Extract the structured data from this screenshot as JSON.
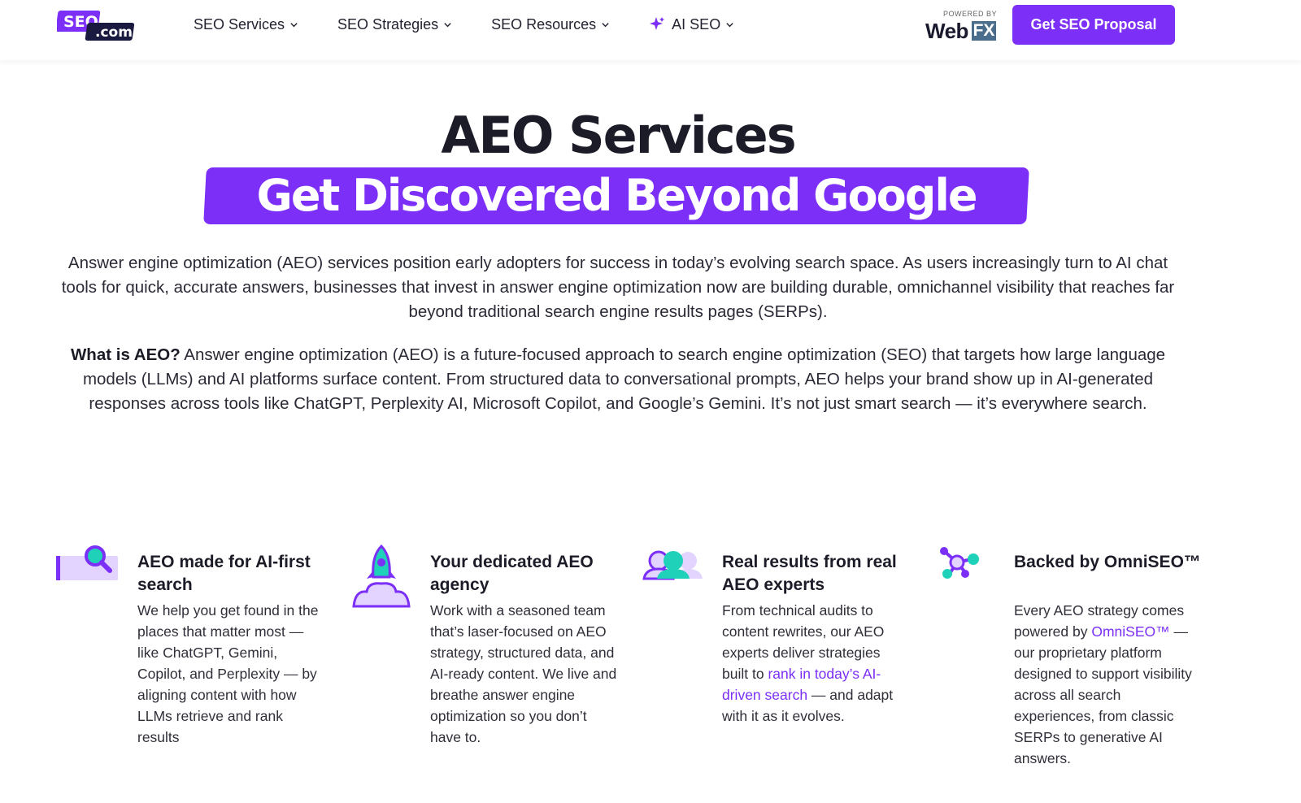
{
  "header": {
    "logo_top": "SEO",
    "logo_bottom": ".com",
    "nav": [
      {
        "label": "SEO Services"
      },
      {
        "label": "SEO Strategies"
      },
      {
        "label": "SEO Resources"
      },
      {
        "label": "AI SEO"
      }
    ],
    "powered_by": "POWERED BY",
    "powered_web": "Web",
    "powered_fx": "FX",
    "cta_label": "Get SEO Proposal"
  },
  "hero": {
    "title": "AEO Services",
    "subtitle": "Get Discovered Beyond Google",
    "intro": "Answer engine optimization (AEO) services position early adopters for success in today’s evolving search space. As users increasingly turn to AI chat tools for quick, accurate answers, businesses that invest in answer engine optimization now are building durable, omnichannel visibility that reaches far beyond traditional search engine results pages (SERPs).",
    "what_label": "What is AEO?",
    "what_text": " Answer engine optimization (AEO) is a future-focused approach to search engine optimization (SEO) that targets how large language models (LLMs) and AI platforms surface content. From structured data to conversational prompts, AEO helps your brand show up in AI-generated responses across tools like ChatGPT, Perplexity AI, Microsoft Copilot, and Google’s Gemini. It’s not just smart search — it’s everywhere search."
  },
  "features": [
    {
      "title": "AEO made for AI-first search",
      "text": "We help you get found in the places that matter most — like ChatGPT, Gemini, Copilot, and Perplexity — by aligning content with how LLMs retrieve and rank results",
      "icon": "search-magnifier-icon"
    },
    {
      "title": "Your dedicated AEO agency",
      "text": "Work with a seasoned team that’s laser-focused on AEO strategy, structured data, and AI-ready content. We live and breathe answer engine optimization so you don’t have to.",
      "icon": "rocket-icon"
    },
    {
      "title": "Real results from real AEO experts",
      "text_before": "From technical audits to content rewrites, our AEO experts deliver strategies built to ",
      "link": "rank in today’s AI-driven search",
      "text_after": " — and adapt with it as it evolves.",
      "icon": "people-icon"
    },
    {
      "title": "Backed by OmniSEO™",
      "text_before": "Every AEO strategy comes powered by ",
      "link": "OmniSEO™",
      "text_after": " — our proprietary platform designed to support visibility across all search experiences, from classic SERPs to generative AI answers.",
      "icon": "network-icon"
    }
  ],
  "colors": {
    "accent": "#7b2ff7",
    "teal": "#1fd1b8",
    "lavender": "#e2d3ff"
  }
}
